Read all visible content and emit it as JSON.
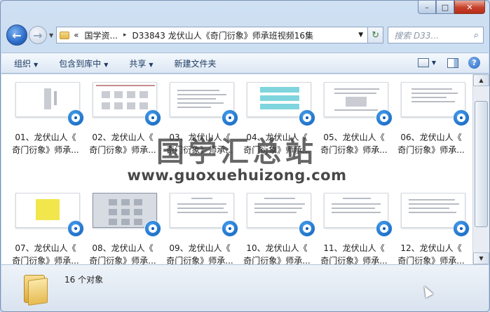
{
  "window": {
    "back_glyph": "←",
    "forward_glyph": "→",
    "history_glyph": "▼",
    "caption": {
      "minimize": "–",
      "maximize": "□",
      "close": "✕"
    }
  },
  "address": {
    "chevrons": "«",
    "crumbs": [
      "国学资...",
      "D33843 龙伏山人《奇门衍象》师承班视频16集"
    ],
    "separator": "▸",
    "dropdown": "▼",
    "refresh": "↻"
  },
  "search": {
    "placeholder": "搜索 D33...",
    "icon": "⌕"
  },
  "toolbar": {
    "organize": "组织",
    "include_library": "包含到库中",
    "share": "共享",
    "new_folder": "新建文件夹",
    "caret": "▼",
    "help": "?"
  },
  "files": [
    {
      "line1": "01、龙伏山人《",
      "line2": "奇门衍象》师承..."
    },
    {
      "line1": "02、龙伏山人《",
      "line2": "奇门衍象》师承..."
    },
    {
      "line1": "03、龙伏山人《",
      "line2": "奇门衍象》师承..."
    },
    {
      "line1": "04、龙伏山人《",
      "line2": "奇门衍象》师承..."
    },
    {
      "line1": "05、龙伏山人《",
      "line2": "奇门衍象》师承..."
    },
    {
      "line1": "06、龙伏山人《",
      "line2": "奇门衍象》师承..."
    },
    {
      "line1": "07、龙伏山人《",
      "line2": "奇门衍象》师承..."
    },
    {
      "line1": "08、龙伏山人《",
      "line2": "奇门衍象》师承..."
    },
    {
      "line1": "09、龙伏山人《",
      "line2": "奇门衍象》师承..."
    },
    {
      "line1": "10、龙伏山人《",
      "line2": "奇门衍象》师承..."
    },
    {
      "line1": "11、龙伏山人《",
      "line2": "奇门衍象》师承..."
    },
    {
      "line1": "12、龙伏山人《",
      "line2": "奇门衍象》师承..."
    }
  ],
  "watermark": {
    "cn": "国学汇总站",
    "url": "www.guoxuehuizong.com"
  },
  "scroll": {
    "up": "▲",
    "down": "▼"
  },
  "status": {
    "count": "16 个对象"
  }
}
